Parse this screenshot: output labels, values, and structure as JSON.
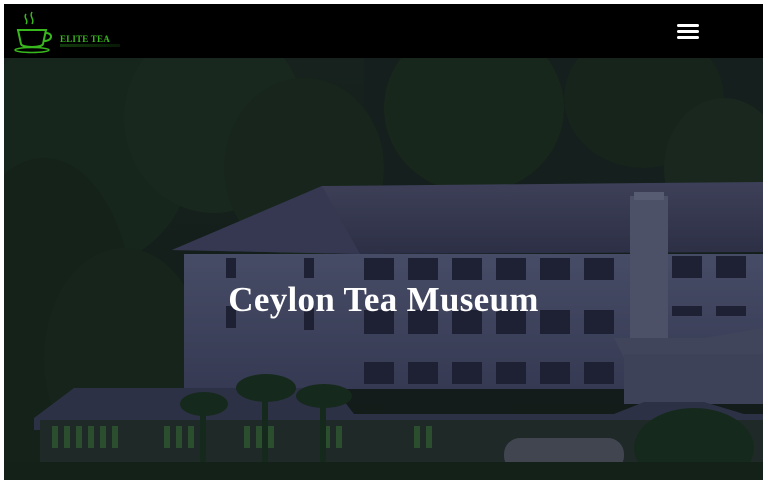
{
  "header": {
    "logo_text": "ELITE TEA",
    "logo_icon": "tea-cup-icon",
    "menu_icon": "hamburger-menu-icon"
  },
  "hero": {
    "title": "Ceylon Tea Museum",
    "background": "tea-factory-photo"
  },
  "colors": {
    "navbar": "#000000",
    "logo_green": "#39b81e",
    "title": "#ffffff"
  }
}
